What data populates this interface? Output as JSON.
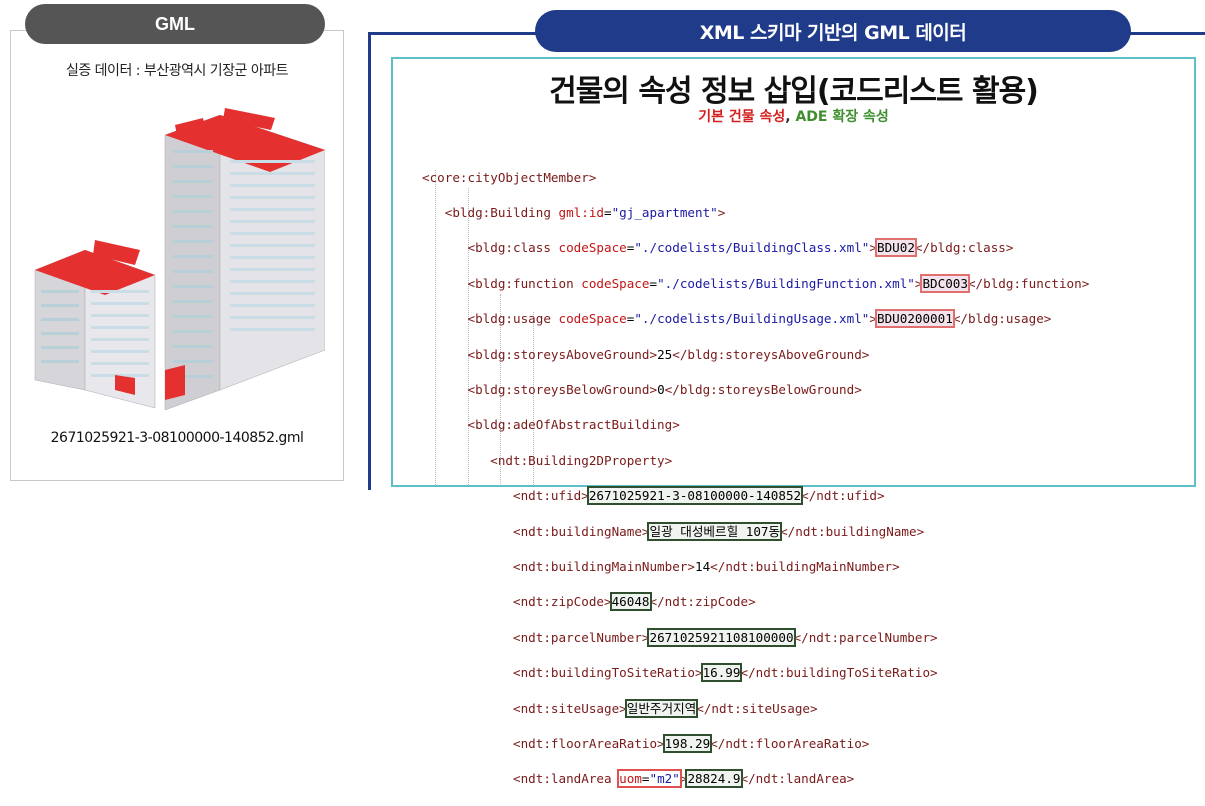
{
  "left_panel": {
    "tab_label": "GML",
    "subtitle": "실증 데이터 : 부산광역시 기장군 아파트",
    "filename": "2671025921-3-08100000-140852.gml"
  },
  "right_panel": {
    "tab_label": "XML 스키마 기반의 GML 데이터",
    "heading": "건물의 속성 정보 삽입(코드리스트 활용)",
    "legend_red": "기본 건물 속성",
    "legend_sep": ", ",
    "legend_green": "ADE 확장 속성"
  },
  "code": {
    "l1_tag": "<core:cityObjectMember>",
    "l2_a": "<bldg:Building ",
    "l2_attr": "gml:id",
    "l2_eq": "=",
    "l2_val": "\"gj_apartment\"",
    "l2_close": ">",
    "l3_a": "<bldg:class ",
    "l3_attr": "codeSpace",
    "l3_eq": "=",
    "l3_val": "\"./codelists/BuildingClass.xml\"",
    "l3_gt": ">",
    "l3_text": "BDU02",
    "l3_end": "</bldg:class>",
    "l4_a": "<bldg:function ",
    "l4_attr": "codeSpace",
    "l4_eq": "=",
    "l4_val": "\"./codelists/BuildingFunction.xml\"",
    "l4_gt": ">",
    "l4_text": "BDC003",
    "l4_end": "</bldg:function>",
    "l5_a": "<bldg:usage ",
    "l5_attr": "codeSpace",
    "l5_eq": "=",
    "l5_val": "\"./codelists/BuildingUsage.xml\"",
    "l5_gt": ">",
    "l5_text": "BDU0200001",
    "l5_end": "</bldg:usage>",
    "l6_a": "<bldg:storeysAboveGround>",
    "l6_text": "25",
    "l6_end": "</bldg:storeysAboveGround>",
    "l7_a": "<bldg:storeysBelowGround>",
    "l7_text": "0",
    "l7_end": "</bldg:storeysBelowGround>",
    "l8_tag": "<bldg:adeOfAbstractBuilding>",
    "l9_tag": "<ndt:Building2DProperty>",
    "l10_a": "<ndt:ufid>",
    "l10_text": "2671025921-3-08100000-140852",
    "l10_end": "</ndt:ufid>",
    "l11_a": "<ndt:buildingName>",
    "l11_text": "일광 대성베르힐 107동",
    "l11_end": "</ndt:buildingName>",
    "l12_a": "<ndt:buildingMainNumber>",
    "l12_text": "14",
    "l12_end": "</ndt:buildingMainNumber>",
    "l13_a": "<ndt:zipCode>",
    "l13_text": "46048",
    "l13_end": "</ndt:zipCode>",
    "l14_a": "<ndt:parcelNumber>",
    "l14_text": "2671025921108100000",
    "l14_end": "</ndt:parcelNumber>",
    "l15_a": "<ndt:buildingToSiteRatio>",
    "l15_text": "16.99",
    "l15_end": "</ndt:buildingToSiteRatio>",
    "l16_a": "<ndt:siteUsage>",
    "l16_text": "일반주거지역",
    "l16_end": "</ndt:siteUsage>",
    "l17_a": "<ndt:floorAreaRatio>",
    "l17_text": "198.29",
    "l17_end": "</ndt:floorAreaRatio>",
    "l18_a": "<ndt:landArea ",
    "l18_attr": "uom",
    "l18_eq": "=",
    "l18_val": "\"m2\"",
    "l18_gt": ">",
    "l18_text": "28824.9",
    "l18_end": "</ndt:landArea>"
  },
  "colors": {
    "panel_tab_gray": "#555555",
    "panel_tab_blue": "#1f3b8a",
    "code_box_border": "#5fbfc9",
    "basic_attr_red": "#d42020",
    "ade_attr_green": "#3f8f2f"
  }
}
